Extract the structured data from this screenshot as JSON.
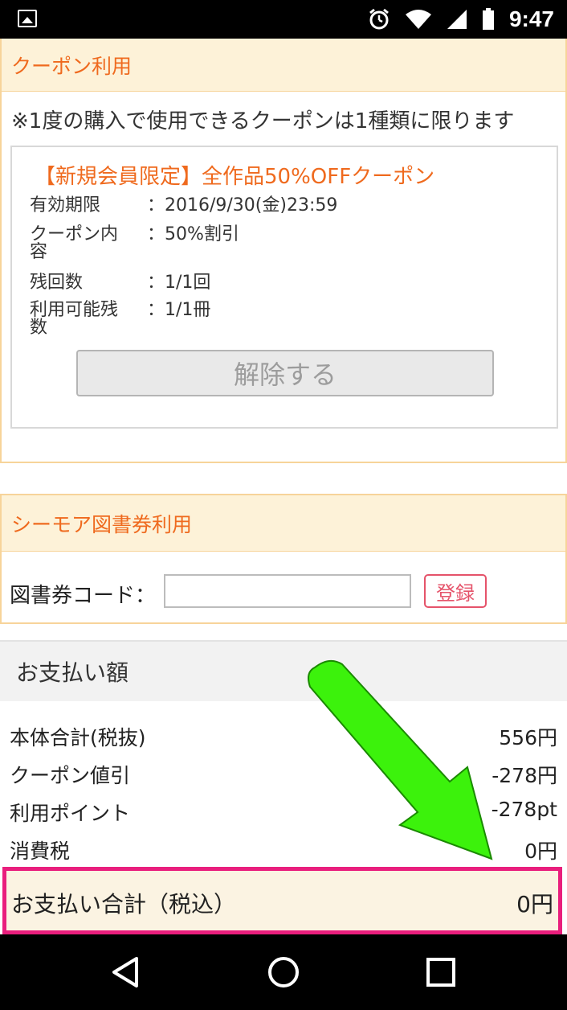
{
  "status_bar": {
    "time": "9:47",
    "icons": [
      "image-icon",
      "alarm-icon",
      "wifi-icon",
      "signal-icon",
      "battery-icon"
    ]
  },
  "coupon": {
    "header": "クーポン利用",
    "note": "※1度の購入で使用できるクーポンは1種類に限ります",
    "title": "【新規会員限定】全作品50%OFFクーポン",
    "rows": [
      {
        "label": "有効期限",
        "value": "：2016/9/30(金)23:59"
      },
      {
        "label": "クーポン内容",
        "value": "：50%割引"
      },
      {
        "label": "残回数",
        "value": "：1/1回"
      },
      {
        "label": "利用可能残数",
        "value": "：1/1冊"
      }
    ],
    "release_button": "解除する"
  },
  "book_coupon": {
    "header": "シーモア図書券利用",
    "label": "図書券コード：",
    "input_value": "",
    "register_button": "登録"
  },
  "payment": {
    "header": "お支払い額",
    "rows": [
      {
        "label": "本体合計(税抜)",
        "value": "556円"
      },
      {
        "label": "クーポン値引",
        "value": "-278円"
      },
      {
        "label": "利用ポイント",
        "value": "-278pt"
      },
      {
        "label": "消費税",
        "value": "0円"
      }
    ],
    "total_label": "お支払い合計（税込）",
    "total_value": "0円"
  },
  "colors": {
    "accent_orange": "#ef6a1e",
    "header_bg": "#fdf2d8",
    "highlight_pink": "#e91e7d",
    "arrow_green": "#3cf20c"
  }
}
